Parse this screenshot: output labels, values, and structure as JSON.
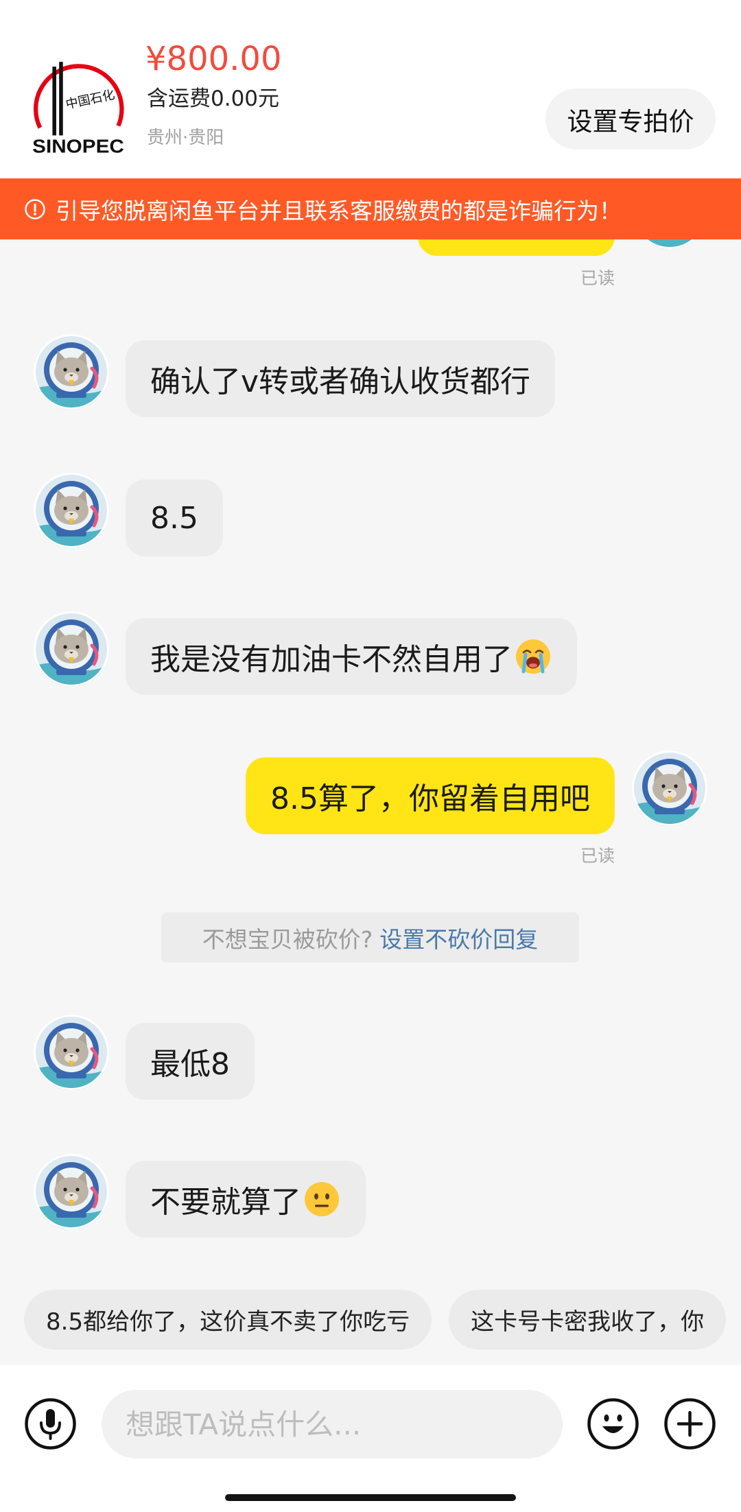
{
  "header": {
    "logo": {
      "text_cn": "中国石化",
      "text_en": "SINOPEC"
    },
    "price": "¥800.00",
    "shipping": "含运费0.00元",
    "location": "贵州·贵阳",
    "set_price_button": "设置专拍价"
  },
  "warning": {
    "icon": "exclamation-circle-icon",
    "text": "引导您脱离闲鱼平台并且联系客服缴费的都是诈骗行为！"
  },
  "chat": {
    "avatar_icon": "cat-astronaut-avatar",
    "earlier_read_receipt": "已读",
    "messages": [
      {
        "text": "确认了v转或者确认收货都行"
      },
      {
        "text": "8.5"
      },
      {
        "text": "我是没有加油卡不然自用了",
        "emoji": "loudly-crying-face-icon"
      },
      {
        "text": "8.5算了，你留着自用吧",
        "read_receipt": "已读"
      },
      {
        "text": "最低8"
      },
      {
        "text": "不要就算了",
        "emoji": "neutral-face-icon"
      }
    ],
    "bargain_hint": {
      "prompt": "不想宝贝被砍价?",
      "link": "设置不砍价回复"
    }
  },
  "quick_replies": [
    "8.5都给你了，这价真不卖了你吃亏",
    "这卡号卡密我收了，你"
  ],
  "input_bar": {
    "voice_icon": "mic-icon",
    "placeholder": "想跟TA说点什么...",
    "emoji_icon": "smiley-icon",
    "more_icon": "plus-icon"
  },
  "colors": {
    "price_red": "#F24B3C",
    "warning_bg": "#FF5A26",
    "my_bubble": "#FFE515",
    "their_bubble": "#ECECEC",
    "link_blue": "#4A79A8",
    "background": "#F6F6F6"
  }
}
